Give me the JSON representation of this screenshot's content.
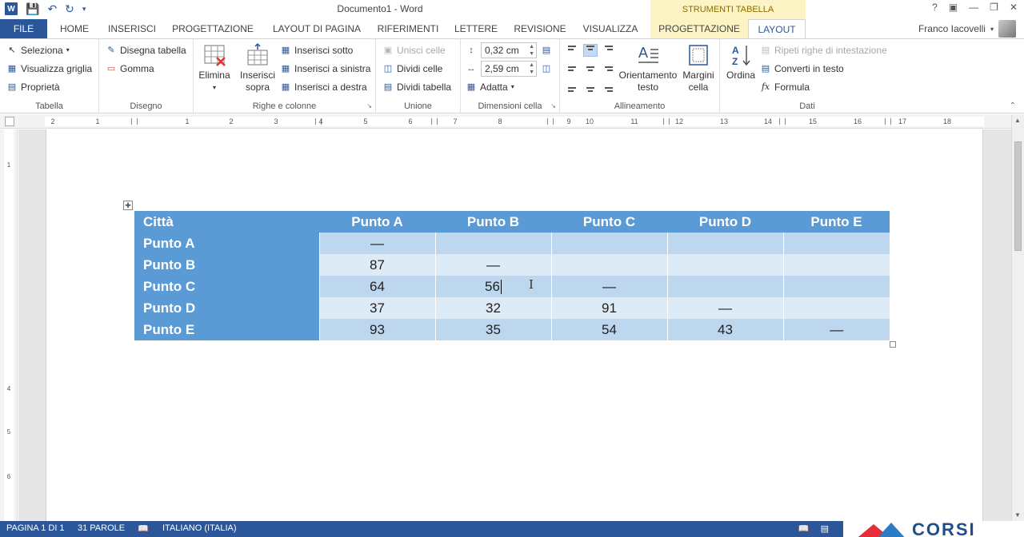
{
  "app": {
    "title": "Documento1 - Word",
    "context_header": "STRUMENTI TABELLA",
    "user": "Franco Iacovelli"
  },
  "tabs": [
    {
      "label": "FILE"
    },
    {
      "label": "HOME"
    },
    {
      "label": "INSERISCI"
    },
    {
      "label": "PROGETTAZIONE"
    },
    {
      "label": "LAYOUT DI PAGINA"
    },
    {
      "label": "RIFERIMENTI"
    },
    {
      "label": "LETTERE"
    },
    {
      "label": "REVISIONE"
    },
    {
      "label": "VISUALIZZA"
    },
    {
      "label": "PROGETTAZIONE"
    },
    {
      "label": "LAYOUT"
    }
  ],
  "ribbon": {
    "tabella": {
      "label": "Tabella",
      "seleziona": "Seleziona",
      "visualizza_griglia": "Visualizza griglia",
      "proprieta": "Proprietà"
    },
    "disegno": {
      "label": "Disegno",
      "disegna_tabella": "Disegna tabella",
      "gomma": "Gomma"
    },
    "righe_colonne": {
      "label": "Righe e colonne",
      "elimina": "Elimina",
      "inserisci_sopra_1": "Inserisci",
      "inserisci_sopra_2": "sopra",
      "inserisci_sotto": "Inserisci sotto",
      "inserisci_sinistra": "Inserisci a sinistra",
      "inserisci_destra": "Inserisci a destra"
    },
    "unione": {
      "label": "Unione",
      "unisci_celle": "Unisci celle",
      "dividi_celle": "Dividi celle",
      "dividi_tabella": "Dividi tabella"
    },
    "dimensioni": {
      "label": "Dimensioni cella",
      "altezza": "0,32 cm",
      "larghezza": "2,59 cm",
      "adatta": "Adatta"
    },
    "allineamento": {
      "label": "Allineamento",
      "orientamento_1": "Orientamento",
      "orientamento_2": "testo",
      "margini_1": "Margini",
      "margini_2": "cella"
    },
    "dati": {
      "label": "Dati",
      "ordina": "Ordina",
      "ripeti": "Ripeti righe di intestazione",
      "converti": "Converti in testo",
      "formula": "Formula"
    }
  },
  "ruler": {
    "h_labels": [
      "2",
      "1",
      "1",
      "2",
      "3",
      "4",
      "5",
      "6",
      "7",
      "8",
      "9",
      "10",
      "11",
      "12",
      "13",
      "14",
      "15",
      "16",
      "17",
      "18"
    ],
    "v_labels": [
      "1",
      "4",
      "5",
      "6"
    ]
  },
  "table": {
    "headers": [
      "Città",
      "Punto A",
      "Punto B",
      "Punto C",
      "Punto D",
      "Punto E"
    ],
    "rows": [
      {
        "name": "Punto A",
        "values": [
          "—",
          "",
          "",
          "",
          ""
        ]
      },
      {
        "name": "Punto B",
        "values": [
          "87",
          "—",
          "",
          "",
          ""
        ]
      },
      {
        "name": "Punto C",
        "values": [
          "64",
          "56",
          "—",
          "",
          ""
        ]
      },
      {
        "name": "Punto D",
        "values": [
          "37",
          "32",
          "91",
          "—",
          ""
        ]
      },
      {
        "name": "Punto E",
        "values": [
          "93",
          "35",
          "54",
          "43",
          "—"
        ]
      }
    ]
  },
  "status": {
    "page": "PAGINA 1 DI 1",
    "words": "31 PAROLE",
    "language": "ITALIANO (ITALIA)"
  },
  "colors": {
    "accent": "#2b579a",
    "table_header": "#5b9bd5",
    "row_odd": "#bdd7ee",
    "row_even": "#ddebf7",
    "context_tab": "#fdf4c5"
  }
}
